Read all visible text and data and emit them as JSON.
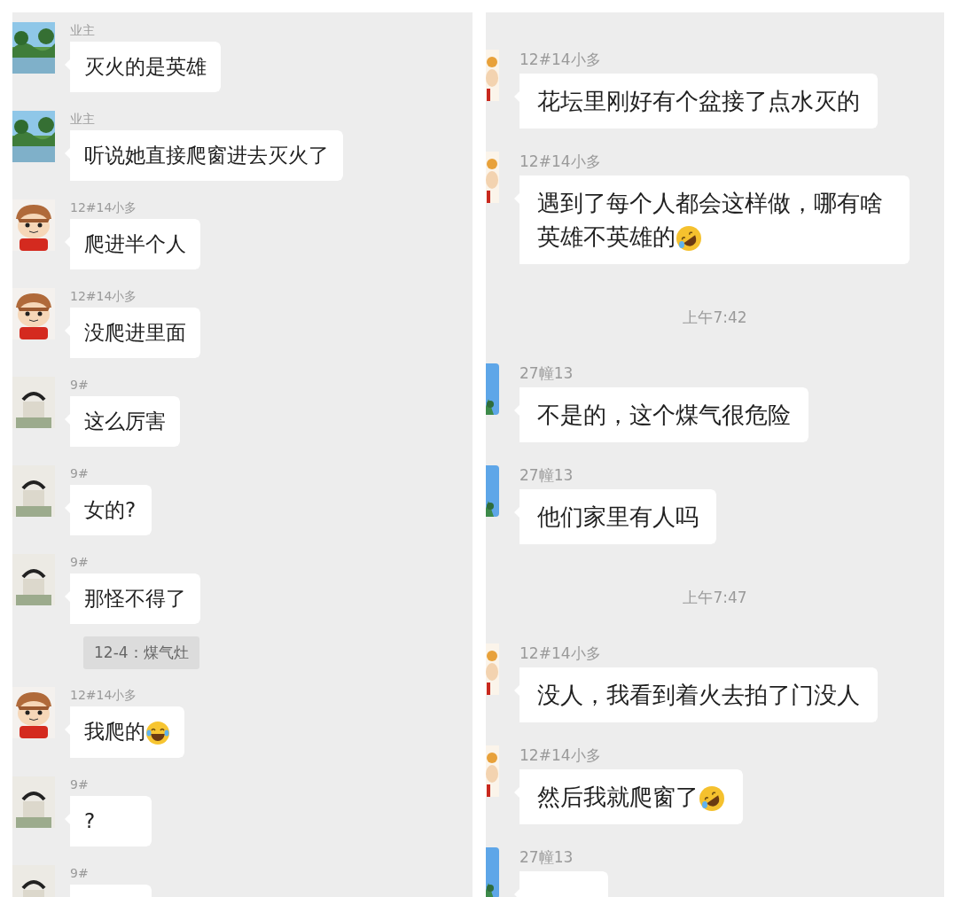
{
  "panels": [
    {
      "items": [
        {
          "kind": "message",
          "sender": "业主",
          "avatar": {
            "kind": "landscape"
          },
          "text": "灭火的是英雄"
        },
        {
          "kind": "message",
          "sender": "业主",
          "avatar": {
            "kind": "landscape"
          },
          "text": "听说她直接爬窗进去灭火了"
        },
        {
          "kind": "message",
          "sender": "12#14小多",
          "avatar": {
            "kind": "cartoon"
          },
          "text": "爬进半个人"
        },
        {
          "kind": "message",
          "sender": "12#14小多",
          "avatar": {
            "kind": "cartoon"
          },
          "text": "没爬进里面"
        },
        {
          "kind": "message",
          "sender": "9#",
          "avatar": {
            "kind": "sketch"
          },
          "text": "这么厉害"
        },
        {
          "kind": "message",
          "sender": "9#",
          "avatar": {
            "kind": "sketch"
          },
          "text": "女的?"
        },
        {
          "kind": "message",
          "sender": "9#",
          "avatar": {
            "kind": "sketch"
          },
          "text": "那怪不得了"
        },
        {
          "kind": "notice",
          "text": "12-4：煤气灶"
        },
        {
          "kind": "message",
          "sender": "12#14小多",
          "avatar": {
            "kind": "cartoon"
          },
          "text": "我爬的",
          "emoji": {
            "kind": "laugh"
          }
        },
        {
          "kind": "message",
          "sender": "9#",
          "avatar": {
            "kind": "sketch"
          },
          "text": "?"
        },
        {
          "kind": "message",
          "sender": "9#",
          "avatar": {
            "kind": "sketch"
          }
        }
      ]
    },
    {
      "items": [
        {
          "kind": "message",
          "sender": "12#14小多",
          "avatar": {
            "kind": "figure"
          },
          "text": "花坛里刚好有个盆接了点水灭的"
        },
        {
          "kind": "message",
          "sender": "12#14小多",
          "avatar": {
            "kind": "figure"
          },
          "text": "遇到了每个人都会这样做，哪有啥英雄不英雄的",
          "emoji": {
            "kind": "tilted"
          }
        },
        {
          "kind": "time",
          "text": "上午7:42"
        },
        {
          "kind": "message",
          "sender": "27幢13",
          "avatar": {
            "kind": "blue"
          },
          "text": "不是的，这个煤气很危险"
        },
        {
          "kind": "message",
          "sender": "27幢13",
          "avatar": {
            "kind": "blue"
          },
          "text": "他们家里有人吗"
        },
        {
          "kind": "time",
          "text": "上午7:47"
        },
        {
          "kind": "message",
          "sender": "12#14小多",
          "avatar": {
            "kind": "figure"
          },
          "text": "没人，我看到着火去拍了门没人"
        },
        {
          "kind": "message",
          "sender": "12#14小多",
          "avatar": {
            "kind": "figure"
          },
          "text": "然后我就爬窗了",
          "emoji": {
            "kind": "tilted"
          }
        },
        {
          "kind": "message",
          "sender": "27幢13",
          "avatar": {
            "kind": "blue"
          }
        }
      ]
    }
  ]
}
